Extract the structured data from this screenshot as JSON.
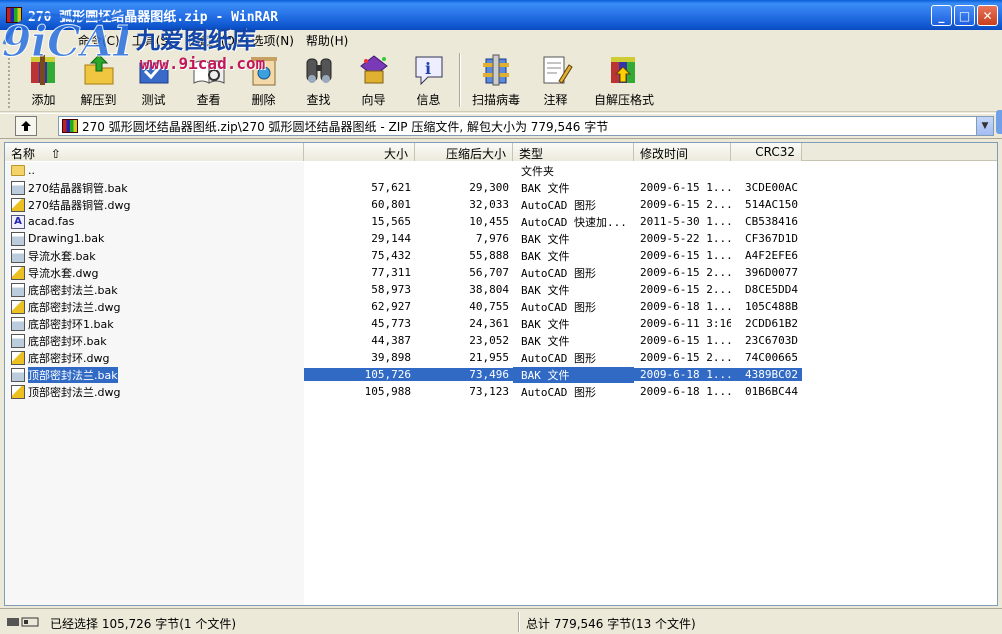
{
  "window": {
    "title": "270 弧形圆坯结晶器图纸.zip - WinRAR",
    "min_label": "_",
    "max_label": "□",
    "close_label": "✕"
  },
  "watermark": {
    "cn": "九爱图纸库",
    "url": "www.9icad.com"
  },
  "menu": {
    "items": [
      "命令(C)",
      "工具(S)",
      "收藏夹(O)",
      "选项(N)",
      "帮助(H)"
    ]
  },
  "toolbar": {
    "buttons": [
      {
        "label": "添加",
        "icon": "add-archive-icon"
      },
      {
        "label": "解压到",
        "icon": "extract-to-icon"
      },
      {
        "label": "测试",
        "icon": "test-icon"
      },
      {
        "label": "查看",
        "icon": "view-icon"
      },
      {
        "label": "删除",
        "icon": "delete-icon"
      },
      {
        "label": "查找",
        "icon": "find-icon"
      },
      {
        "label": "向导",
        "icon": "wizard-icon"
      },
      {
        "label": "信息",
        "icon": "info-icon"
      },
      {
        "label": "扫描病毒",
        "icon": "virus-scan-icon"
      },
      {
        "label": "注释",
        "icon": "comment-icon"
      },
      {
        "label": "自解压格式",
        "icon": "sfx-icon"
      }
    ]
  },
  "address": {
    "path": "270 弧形圆坯结晶器图纸.zip\\270 弧形圆坯结晶器图纸 - ZIP 压缩文件, 解包大小为 779,546 字节"
  },
  "columns": {
    "name": "名称",
    "size": "大小",
    "packed": "压缩后大小",
    "type": "类型",
    "modified": "修改时间",
    "crc": "CRC32"
  },
  "rows": [
    {
      "name": "..",
      "size": "",
      "packed": "",
      "type": "文件夹",
      "modified": "",
      "crc": "",
      "icon": "folder",
      "selected": false
    },
    {
      "name": "270结晶器铜管.bak",
      "size": "57,621",
      "packed": "29,300",
      "type": "BAK 文件",
      "modified": "2009-6-15 1...",
      "crc": "3CDE00AC",
      "icon": "bak",
      "selected": false
    },
    {
      "name": "270结晶器铜管.dwg",
      "size": "60,801",
      "packed": "32,033",
      "type": "AutoCAD 图形",
      "modified": "2009-6-15 2...",
      "crc": "514AC150",
      "icon": "dwg",
      "selected": false
    },
    {
      "name": "acad.fas",
      "size": "15,565",
      "packed": "10,455",
      "type": "AutoCAD 快速加...",
      "modified": "2011-5-30 1...",
      "crc": "CB538416",
      "icon": "fas",
      "selected": false
    },
    {
      "name": "Drawing1.bak",
      "size": "29,144",
      "packed": "7,976",
      "type": "BAK 文件",
      "modified": "2009-5-22 1...",
      "crc": "CF367D1D",
      "icon": "bak",
      "selected": false
    },
    {
      "name": "导流水套.bak",
      "size": "75,432",
      "packed": "55,888",
      "type": "BAK 文件",
      "modified": "2009-6-15 1...",
      "crc": "A4F2EFE6",
      "icon": "bak",
      "selected": false
    },
    {
      "name": "导流水套.dwg",
      "size": "77,311",
      "packed": "56,707",
      "type": "AutoCAD 图形",
      "modified": "2009-6-15 2...",
      "crc": "396D0077",
      "icon": "dwg",
      "selected": false
    },
    {
      "name": "底部密封法兰.bak",
      "size": "58,973",
      "packed": "38,804",
      "type": "BAK 文件",
      "modified": "2009-6-15 2...",
      "crc": "D8CE5DD4",
      "icon": "bak",
      "selected": false
    },
    {
      "name": "底部密封法兰.dwg",
      "size": "62,927",
      "packed": "40,755",
      "type": "AutoCAD 图形",
      "modified": "2009-6-18 1...",
      "crc": "105C488B",
      "icon": "dwg",
      "selected": false
    },
    {
      "name": "底部密封环1.bak",
      "size": "45,773",
      "packed": "24,361",
      "type": "BAK 文件",
      "modified": "2009-6-11 3:16",
      "crc": "2CDD61B2",
      "icon": "bak",
      "selected": false
    },
    {
      "name": "底部密封环.bak",
      "size": "44,387",
      "packed": "23,052",
      "type": "BAK 文件",
      "modified": "2009-6-15 1...",
      "crc": "23C6703D",
      "icon": "bak",
      "selected": false
    },
    {
      "name": "底部密封环.dwg",
      "size": "39,898",
      "packed": "21,955",
      "type": "AutoCAD 图形",
      "modified": "2009-6-15 2...",
      "crc": "74C00665",
      "icon": "dwg",
      "selected": false
    },
    {
      "name": "顶部密封法兰.bak",
      "size": "105,726",
      "packed": "73,496",
      "type": "BAK 文件",
      "modified": "2009-6-18 1...",
      "crc": "4389BC02",
      "icon": "bak",
      "selected": true
    },
    {
      "name": "顶部密封法兰.dwg",
      "size": "105,988",
      "packed": "73,123",
      "type": "AutoCAD 图形",
      "modified": "2009-6-18 1...",
      "crc": "01B6BC44",
      "icon": "dwg",
      "selected": false
    }
  ],
  "status": {
    "left": "已经选择 105,726 字节(1 个文件)",
    "right": "总计 779,546 字节(13 个文件)"
  },
  "colors": {
    "selection": "#316ac5",
    "titlebar": "#2a75ea"
  }
}
